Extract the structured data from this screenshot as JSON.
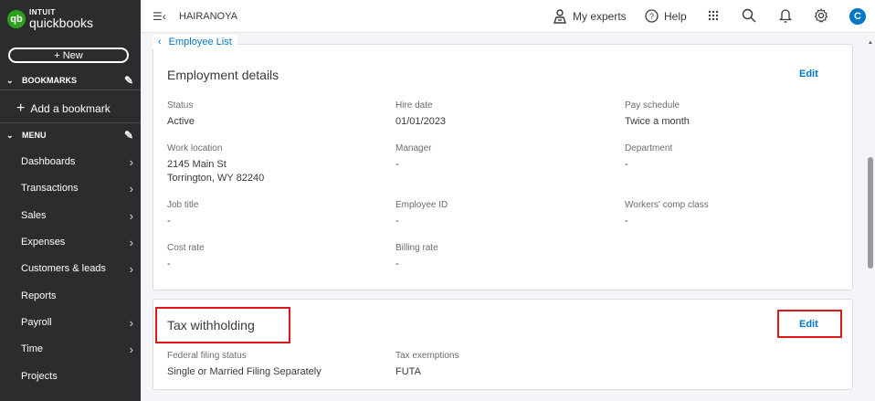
{
  "sidebar": {
    "logo_top": "INTUIT",
    "logo_main": "quickbooks",
    "logo_mark": "qb",
    "new_label": "+ New",
    "bookmarks_label": "BOOKMARKS",
    "add_bookmark_label": "Add a bookmark",
    "menu_label": "MENU",
    "items": [
      {
        "label": "Dashboards",
        "has_arrow": true
      },
      {
        "label": "Transactions",
        "has_arrow": true
      },
      {
        "label": "Sales",
        "has_arrow": true
      },
      {
        "label": "Expenses",
        "has_arrow": true
      },
      {
        "label": "Customers & leads",
        "has_arrow": true
      },
      {
        "label": "Reports",
        "has_arrow": false
      },
      {
        "label": "Payroll",
        "has_arrow": true
      },
      {
        "label": "Time",
        "has_arrow": true
      },
      {
        "label": "Projects",
        "has_arrow": false
      }
    ]
  },
  "topbar": {
    "company": "HAIRANOYA",
    "my_experts": "My experts",
    "help": "Help",
    "avatar_initial": "C"
  },
  "breadcrumb": {
    "label": "Employee List"
  },
  "employment": {
    "title": "Employment details",
    "edit_label": "Edit",
    "fields": {
      "status": {
        "label": "Status",
        "value": "Active"
      },
      "hire_date": {
        "label": "Hire date",
        "value": "01/01/2023"
      },
      "pay_schedule": {
        "label": "Pay schedule",
        "value": "Twice a month"
      },
      "work_location": {
        "label": "Work location",
        "line1": "2145 Main St",
        "line2": "Torrington, WY 82240"
      },
      "manager": {
        "label": "Manager",
        "value": "-"
      },
      "department": {
        "label": "Department",
        "value": "-"
      },
      "job_title": {
        "label": "Job title",
        "value": "-"
      },
      "employee_id": {
        "label": "Employee ID",
        "value": "-"
      },
      "workers_comp": {
        "label": "Workers' comp class",
        "value": "-"
      },
      "cost_rate": {
        "label": "Cost rate",
        "value": "-"
      },
      "billing_rate": {
        "label": "Billing rate",
        "value": "-"
      }
    }
  },
  "tax": {
    "title": "Tax withholding",
    "edit_label": "Edit",
    "fields": {
      "federal_status": {
        "label": "Federal filing status",
        "value": "Single or Married Filing Separately"
      },
      "exemptions": {
        "label": "Tax exemptions",
        "value": "FUTA"
      }
    }
  },
  "colors": {
    "sidebar_bg": "#2b2c2e",
    "accent_blue": "#0077c5",
    "brand_green": "#2ca01c",
    "highlight_red": "#e01a1a"
  }
}
